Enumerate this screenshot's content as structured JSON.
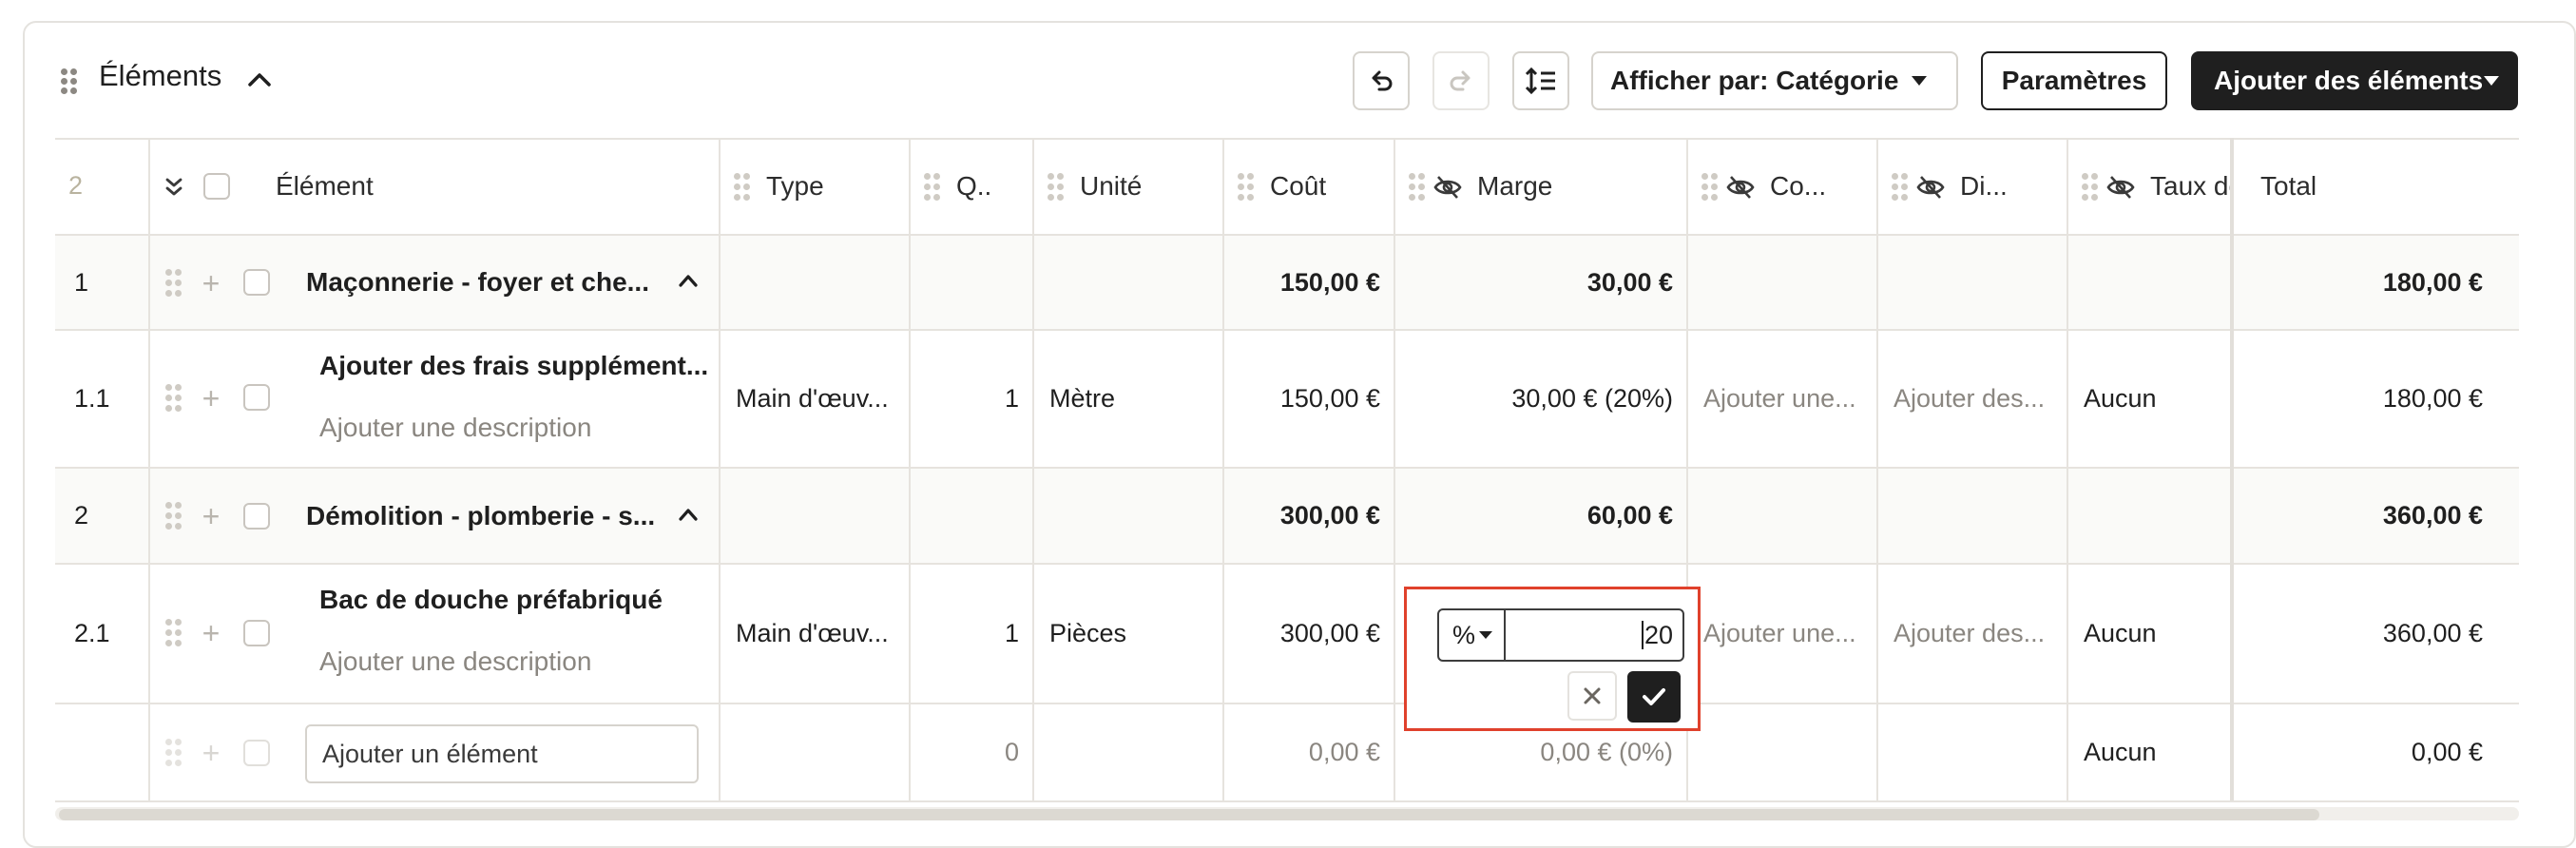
{
  "header": {
    "title": "Éléments",
    "view_select": "Afficher par: Catégorie",
    "settings_label": "Paramètres",
    "add_items_label": "Ajouter des éléments"
  },
  "table": {
    "count": "2",
    "columns": {
      "item": "Élément",
      "type": "Type",
      "qty": "Q..",
      "unit": "Unité",
      "cost": "Coût",
      "margin": "Marge",
      "co": "Co...",
      "di": "Di...",
      "tax": "Taux de",
      "total": "Total"
    },
    "rows": [
      {
        "num": "1",
        "title": "Maçonnerie - foyer et che...",
        "cost": "150,00 €",
        "margin": "30,00 €",
        "total": "180,00 €"
      },
      {
        "num": "1.1",
        "title": "Ajouter des frais supplément...",
        "description": "Ajouter une description",
        "type": "Main d'œuv...",
        "qty": "1",
        "unit": "Mètre",
        "cost": "150,00 €",
        "margin": "30,00 € (20%)",
        "co": "Ajouter une...",
        "di": "Ajouter des...",
        "tax": "Aucun",
        "total": "180,00 €"
      },
      {
        "num": "2",
        "title": "Démolition - plomberie - s...",
        "cost": "300,00 €",
        "margin": "60,00 €",
        "total": "360,00 €"
      },
      {
        "num": "2.1",
        "title": "Bac de douche préfabriqué",
        "description": "Ajouter une description",
        "type": "Main d'œuv...",
        "qty": "1",
        "unit": "Pièces",
        "cost": "300,00 €",
        "co": "Ajouter une...",
        "di": "Ajouter des...",
        "tax": "Aucun",
        "total": "360,00 €"
      }
    ],
    "new_row": {
      "placeholder": "Ajouter un élément",
      "qty": "0",
      "cost": "0,00 €",
      "margin": "0,00 € (0%)",
      "tax": "Aucun",
      "total": "0,00 €"
    }
  },
  "margin_editor": {
    "unit": "%",
    "value": "20"
  },
  "icons": {
    "undo": "undo-icon",
    "redo": "redo-icon",
    "row_height": "line-height-icon",
    "hidden": "eye-off-icon",
    "expand_all": "chevrons-down-icon",
    "collapse": "chevron-up-icon",
    "cancel": "x-icon",
    "confirm": "check-icon"
  },
  "colors": {
    "accent_dark": "#1f1f1f",
    "highlight_border": "#e0412c",
    "group_row_bg": "#fafaf8"
  }
}
